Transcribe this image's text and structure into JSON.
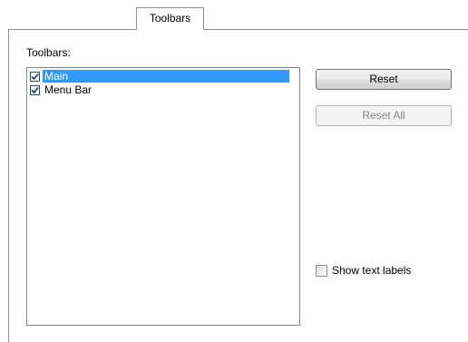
{
  "tabs": [
    {
      "label": "Toolbars",
      "selected": true
    }
  ],
  "toolbars_label": "Toolbars:",
  "toolbars_list": [
    {
      "label": "Main",
      "checked": true,
      "selected": true
    },
    {
      "label": "Menu Bar",
      "checked": true,
      "selected": false
    }
  ],
  "buttons": {
    "reset": "Reset",
    "reset_all": "Reset All"
  },
  "button_states": {
    "reset_all_enabled": false
  },
  "show_text_labels": {
    "label": "Show text labels",
    "checked": false
  },
  "colors": {
    "selection": "#3399ff",
    "border": "#8e8f8f",
    "disabled_text": "#838383"
  },
  "icons": {
    "checkbox_checked": "checkmark-icon"
  }
}
